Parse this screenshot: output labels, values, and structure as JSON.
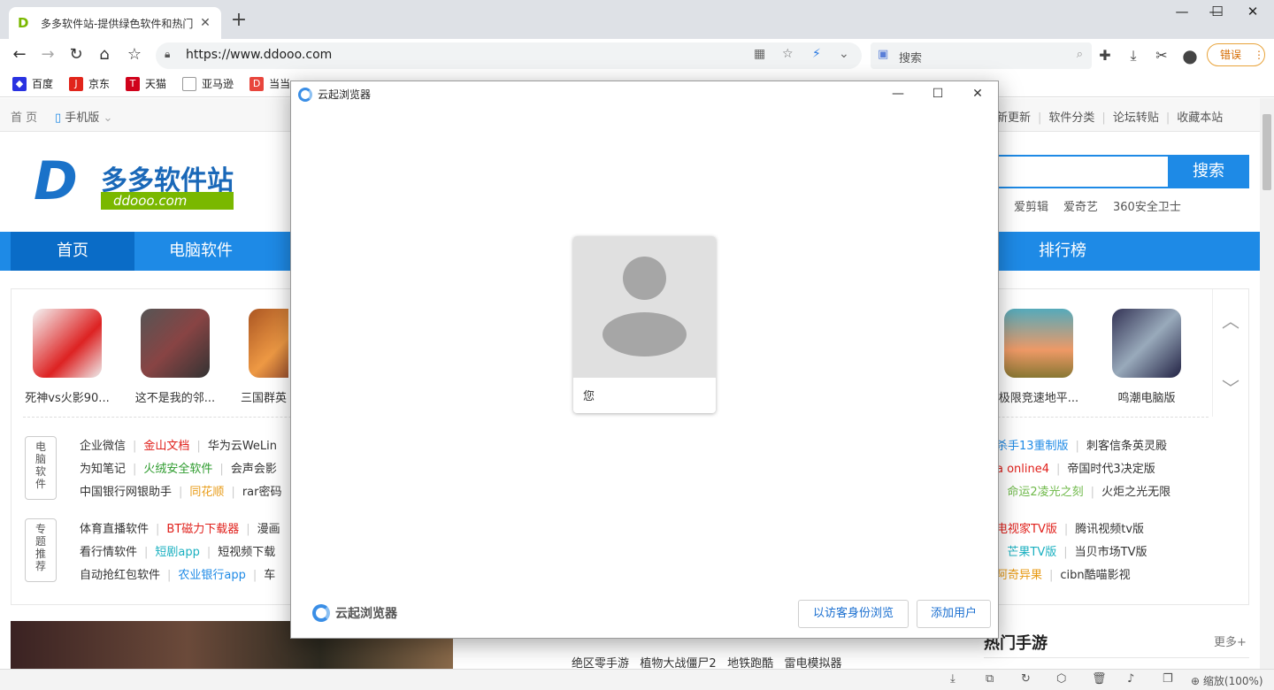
{
  "browser": {
    "tab_title": "多多软件站-提供绿色软件和热门",
    "url": "https://www.ddooo.com",
    "search_placeholder": "搜索",
    "error_label": "错误",
    "bookmarks": [
      "百度",
      "京东",
      "天猫",
      "亚马逊",
      "当当"
    ]
  },
  "page": {
    "top_links": [
      "首 页",
      "手机版"
    ],
    "top_right_links": [
      "新更新",
      "软件分类",
      "论坛转贴",
      "收藏本站"
    ],
    "logo_name": "多多软件站",
    "logo_domain": "ddooo.com",
    "search_button": "搜索",
    "hot_keywords": [
      "爱剪辑",
      "爱奇艺",
      "360安全卫士"
    ],
    "nav": [
      "首页",
      "电脑软件",
      "排行榜"
    ],
    "left_cards": [
      "死神vs火影90...",
      "这不是我的邻...",
      "三国群英"
    ],
    "right_cards": [
      "极限竞速地平...",
      "鸣潮电脑版"
    ],
    "sec1_label": [
      "电",
      "脑",
      "软",
      "件"
    ],
    "sec2_label": [
      "专",
      "题",
      "推",
      "荐"
    ],
    "left_links": [
      [
        "企业微信",
        "金山文档",
        "华为云WeLin"
      ],
      [
        "为知笔记",
        "火绒安全软件",
        "会声会影"
      ],
      [
        "中国银行网银助手",
        "同花顺",
        "rar密码"
      ],
      [
        "体育直播软件",
        "BT磁力下载器",
        "漫画"
      ],
      [
        "看行情软件",
        "短剧app",
        "短视频下载"
      ],
      [
        "自动抢红包软件",
        "农业银行app",
        "车"
      ]
    ],
    "right_links": [
      [
        "杀手13重制版",
        "刺客信条英灵殿"
      ],
      [
        "a online4",
        "帝国时代3决定版"
      ],
      [
        "命运2凌光之刻",
        "火炬之光无限"
      ],
      [
        "电视家TV版",
        "腾讯视频tv版"
      ],
      [
        "芒果TV版",
        "当贝市场TV版"
      ],
      [
        "阿奇异果",
        "cibn酷喵影视"
      ]
    ],
    "bottom_games": [
      "绝区零手游",
      "植物大战僵尸2",
      "地铁跑酷",
      "雷电模拟器"
    ],
    "hot_mobile_title": "热门手游",
    "more": "更多+"
  },
  "dialog": {
    "title": "云起浏览器",
    "profile_name": "您",
    "brand": "云起浏览器",
    "guest_button": "以访客身份浏览",
    "add_user_button": "添加用户"
  },
  "status": {
    "zoom": "缩放(100%)"
  }
}
